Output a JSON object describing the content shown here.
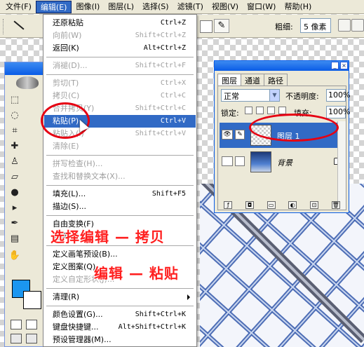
{
  "menubar": {
    "items": [
      {
        "label": "文件(F)"
      },
      {
        "label": "编辑(E)",
        "active": true
      },
      {
        "label": "图像(I)"
      },
      {
        "label": "图层(L)"
      },
      {
        "label": "选择(S)"
      },
      {
        "label": "滤镜(T)"
      },
      {
        "label": "视图(V)"
      },
      {
        "label": "窗口(W)"
      },
      {
        "label": "帮助(H)"
      }
    ]
  },
  "options_bar": {
    "weight_label": "粗细:",
    "weight_value": "5 像素",
    "line_tool_icon": "line-tool-icon",
    "pin_icon": "pushpin-icon"
  },
  "edit_menu": {
    "items": [
      {
        "label": "还原粘贴",
        "shortcut": "Ctrl+Z",
        "disabled": false
      },
      {
        "label": "向前(W)",
        "shortcut": "Shift+Ctrl+Z",
        "disabled": true
      },
      {
        "label": "返回(K)",
        "shortcut": "Alt+Ctrl+Z",
        "disabled": false
      },
      {
        "separator": true
      },
      {
        "label": "消褪(D)...",
        "shortcut": "Shift+Ctrl+F",
        "disabled": true
      },
      {
        "separator": true
      },
      {
        "label": "剪切(T)",
        "shortcut": "Ctrl+X",
        "disabled": true
      },
      {
        "label": "拷贝(C)",
        "shortcut": "Ctrl+C",
        "disabled": true
      },
      {
        "label": "合并拷贝(Y)",
        "shortcut": "Shift+Ctrl+C",
        "disabled": true
      },
      {
        "label": "粘贴(P)",
        "shortcut": "Ctrl+V",
        "disabled": false,
        "selected": true
      },
      {
        "label": "粘贴入(I)",
        "shortcut": "Shift+Ctrl+V",
        "disabled": true
      },
      {
        "label": "清除(E)",
        "shortcut": "",
        "disabled": true
      },
      {
        "separator": true
      },
      {
        "label": "拼写检查(H)...",
        "shortcut": "",
        "disabled": true
      },
      {
        "label": "查找和替换文本(X)...",
        "shortcut": "",
        "disabled": true
      },
      {
        "separator": true
      },
      {
        "label": "填充(L)...",
        "shortcut": "Shift+F5",
        "disabled": false
      },
      {
        "label": "描边(S)...",
        "shortcut": "",
        "disabled": false
      },
      {
        "separator": true
      },
      {
        "label": "自由变换(F)",
        "shortcut": "",
        "disabled": false
      },
      {
        "label": "变换(A)",
        "shortcut": "",
        "disabled": false
      },
      {
        "separator": true
      },
      {
        "label": "定义画笔预设(B)...",
        "shortcut": "",
        "disabled": false
      },
      {
        "label": "定义图案(Q)...",
        "shortcut": "",
        "disabled": false
      },
      {
        "label": "定义自定形状(J)...",
        "shortcut": "",
        "disabled": true
      },
      {
        "separator": true
      },
      {
        "label": "清理(R)",
        "shortcut": "",
        "disabled": false,
        "submenu": true
      },
      {
        "separator": true
      },
      {
        "label": "颜色设置(G)...",
        "shortcut": "Shift+Ctrl+K",
        "disabled": false
      },
      {
        "label": "键盘快捷键...",
        "shortcut": "Alt+Shift+Ctrl+K",
        "disabled": false
      },
      {
        "label": "预设管理器(M)...",
        "shortcut": "",
        "disabled": false
      }
    ]
  },
  "annotations": {
    "caption_copy": "选择编辑 — 拷贝",
    "caption_paste": "编辑 — 粘贴",
    "ring_color": "#e60012"
  },
  "layers_panel": {
    "tabs": [
      "图层",
      "通道",
      "路径"
    ],
    "active_tab": "图层",
    "blend_mode": "正常",
    "opacity_label": "不透明度:",
    "opacity_value": "100%",
    "lock_label": "锁定:",
    "fill_label": "填充:",
    "fill_value": "100%",
    "layers": [
      {
        "name": "图层 1",
        "selected": true,
        "visible": true,
        "italic": false,
        "locked": false
      },
      {
        "name": "背景",
        "selected": false,
        "visible": false,
        "italic": true,
        "locked": true
      }
    ]
  },
  "toolbox": {
    "foreground_color": "#1b96f0",
    "background_color": "#ffffff"
  }
}
